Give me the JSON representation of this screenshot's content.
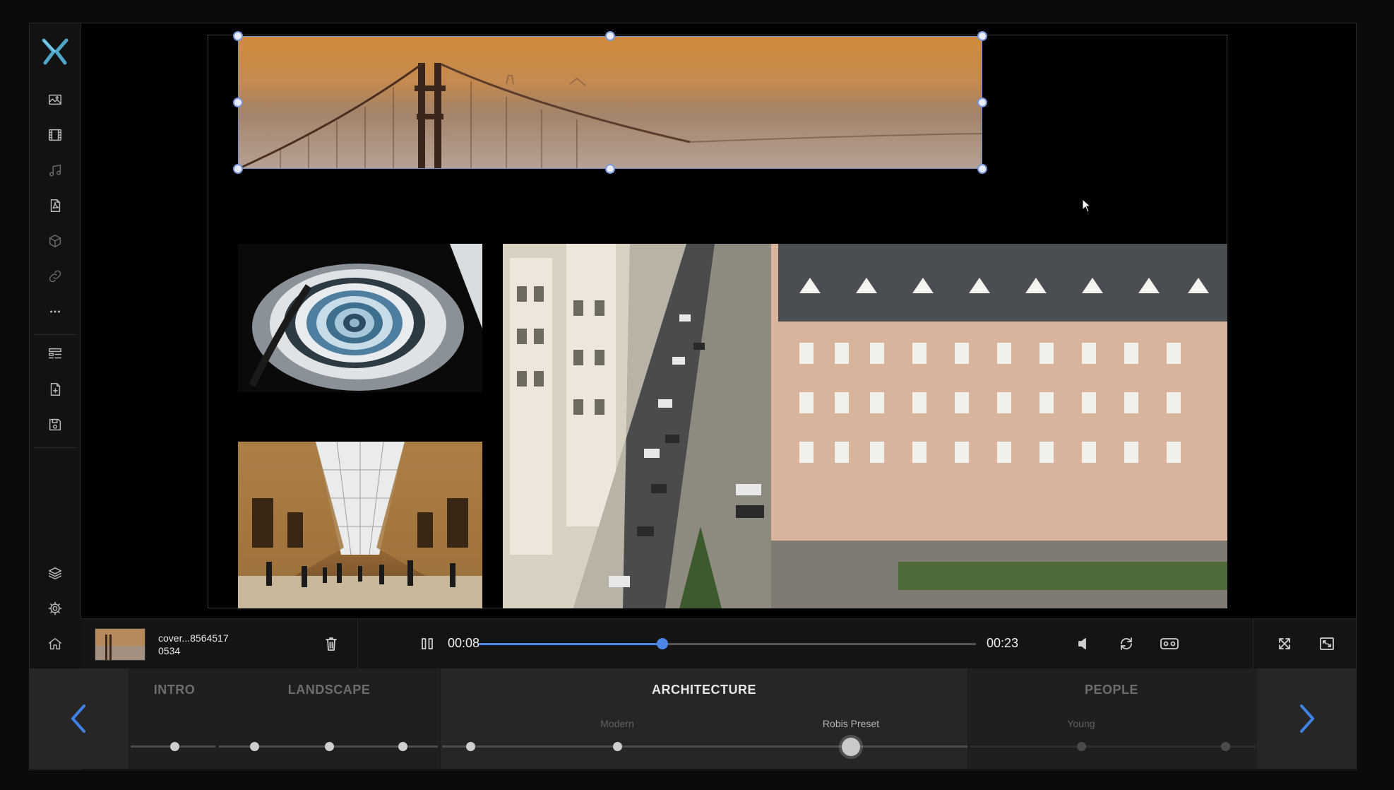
{
  "app": {
    "logo": "x-logo"
  },
  "sidebar": {
    "top_items": [
      {
        "name": "images",
        "icon": "image-icon"
      },
      {
        "name": "videos",
        "icon": "film-icon"
      },
      {
        "name": "audio",
        "icon": "music-icon"
      },
      {
        "name": "pdf",
        "icon": "pdf-icon"
      },
      {
        "name": "3d",
        "icon": "cube-icon"
      },
      {
        "name": "links",
        "icon": "link-icon"
      },
      {
        "name": "more",
        "icon": "more-icon"
      }
    ],
    "mid_items": [
      {
        "name": "templates",
        "icon": "template-icon"
      },
      {
        "name": "new-file",
        "icon": "file-add-icon"
      },
      {
        "name": "save",
        "icon": "save-icon"
      }
    ],
    "bottom_items": [
      {
        "name": "layers",
        "icon": "layers-icon"
      },
      {
        "name": "settings",
        "icon": "gear-icon"
      },
      {
        "name": "home",
        "icon": "home-icon"
      }
    ]
  },
  "player": {
    "file_name": "cover...8564517\n0534",
    "current_time": "00:08",
    "duration": "00:23",
    "progress": 0.37,
    "state": "playing"
  },
  "timeline": {
    "chapters": [
      {
        "label": "INTRO",
        "active": false
      },
      {
        "label": "LANDSCAPE",
        "active": false
      },
      {
        "label": "ARCHITECTURE",
        "active": true
      },
      {
        "label": "PEOPLE",
        "active": false
      }
    ],
    "sub_labels": [
      {
        "label": "Modern",
        "active": false
      },
      {
        "label": "Robis Preset",
        "active": true
      },
      {
        "label": "Young",
        "active": false
      }
    ]
  },
  "colors": {
    "accent": "#4a86e8",
    "selection": "#6f8fd8",
    "background": "#000000"
  }
}
